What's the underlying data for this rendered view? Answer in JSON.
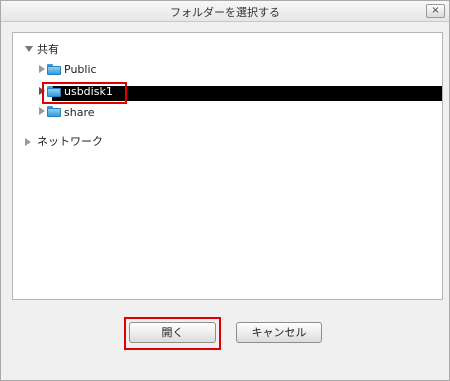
{
  "dialog": {
    "title": "フォルダーを選択する",
    "close_label": "×"
  },
  "tree": {
    "root": {
      "label": "共有",
      "expanded": true
    },
    "items": [
      {
        "label": "Public",
        "expanded": false,
        "selected": false
      },
      {
        "label": "usbdisk1",
        "expanded": false,
        "selected": true
      },
      {
        "label": "share",
        "expanded": false,
        "selected": false
      }
    ],
    "network": {
      "label": "ネットワーク",
      "expanded": false
    }
  },
  "buttons": {
    "open_label": "開く",
    "cancel_label": "キャンセル"
  },
  "colors": {
    "highlight": "#e00000",
    "selection": "#000000",
    "folder": "#3a9ad8"
  }
}
